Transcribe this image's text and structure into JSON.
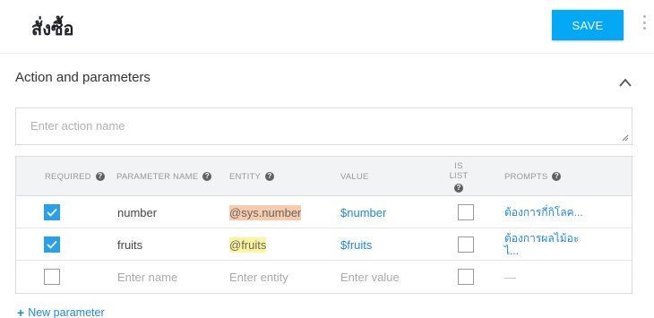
{
  "header": {
    "intent_title": "สั่งซื้อ",
    "save_label": "SAVE",
    "menu_icon": "more-vert-icon"
  },
  "section": {
    "title": "Action and parameters",
    "collapse_icon": "chevron-up-icon"
  },
  "action_input": {
    "placeholder": "Enter action name",
    "value": ""
  },
  "table": {
    "headers": {
      "required": "REQUIRED",
      "parameter_name": "PARAMETER NAME",
      "entity": "ENTITY",
      "value": "VALUE",
      "is_list": "IS LIST",
      "prompts": "PROMPTS"
    },
    "help_glyph": "?",
    "rows": [
      {
        "required": true,
        "name": "number",
        "entity": "@sys.number",
        "value": "$number",
        "is_list": false,
        "prompt": "ต้องการกี่กิโลค..."
      },
      {
        "required": true,
        "name": "fruits",
        "entity": "@fruits",
        "value": "$fruits",
        "is_list": false,
        "prompt": "ต้องการผลไม้อะ",
        "prompt_line2": "ไ..."
      }
    ],
    "empty_row": {
      "name_placeholder": "Enter name",
      "entity_placeholder": "Enter entity",
      "value_placeholder": "Enter value",
      "prompt_placeholder": "—"
    }
  },
  "new_parameter": {
    "plus": "+",
    "label": "New parameter"
  },
  "colors": {
    "save_button": "#03a9f4",
    "checkbox_checked": "#29a1e8",
    "link_blue": "#1e88e5",
    "sys_entity_highlight": "#f8cbad",
    "custom_entity_highlight": "#fff59d",
    "header_bg": "#f1f3f4"
  }
}
